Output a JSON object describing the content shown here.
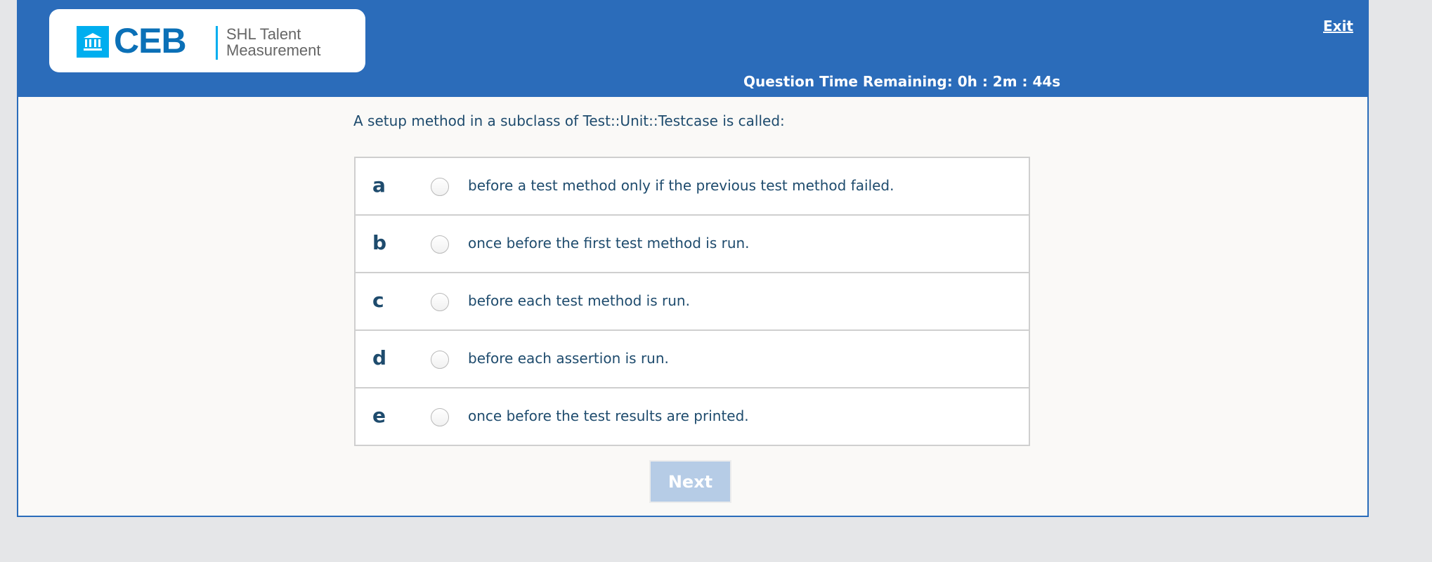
{
  "header": {
    "logo": {
      "brand": "CEB",
      "tagline_line1": "SHL Talent",
      "tagline_line2": "Measurement"
    },
    "exit_label": "Exit",
    "timer": "Question Time Remaining: 0h : 2m : 44s"
  },
  "question": {
    "text": "A setup method in a subclass of Test::Unit::Testcase is called:",
    "options": [
      {
        "letter": "a",
        "text": "before a test method only if the previous test method failed."
      },
      {
        "letter": "b",
        "text": "once before the first test method is run."
      },
      {
        "letter": "c",
        "text": "before each test method is run."
      },
      {
        "letter": "d",
        "text": "before each assertion is run."
      },
      {
        "letter": "e",
        "text": "once before the test results are printed."
      }
    ]
  },
  "next_label": "Next",
  "colors": {
    "header": "#2b6cba",
    "text": "#1e4b6d",
    "next_disabled": "#b6cce6"
  }
}
